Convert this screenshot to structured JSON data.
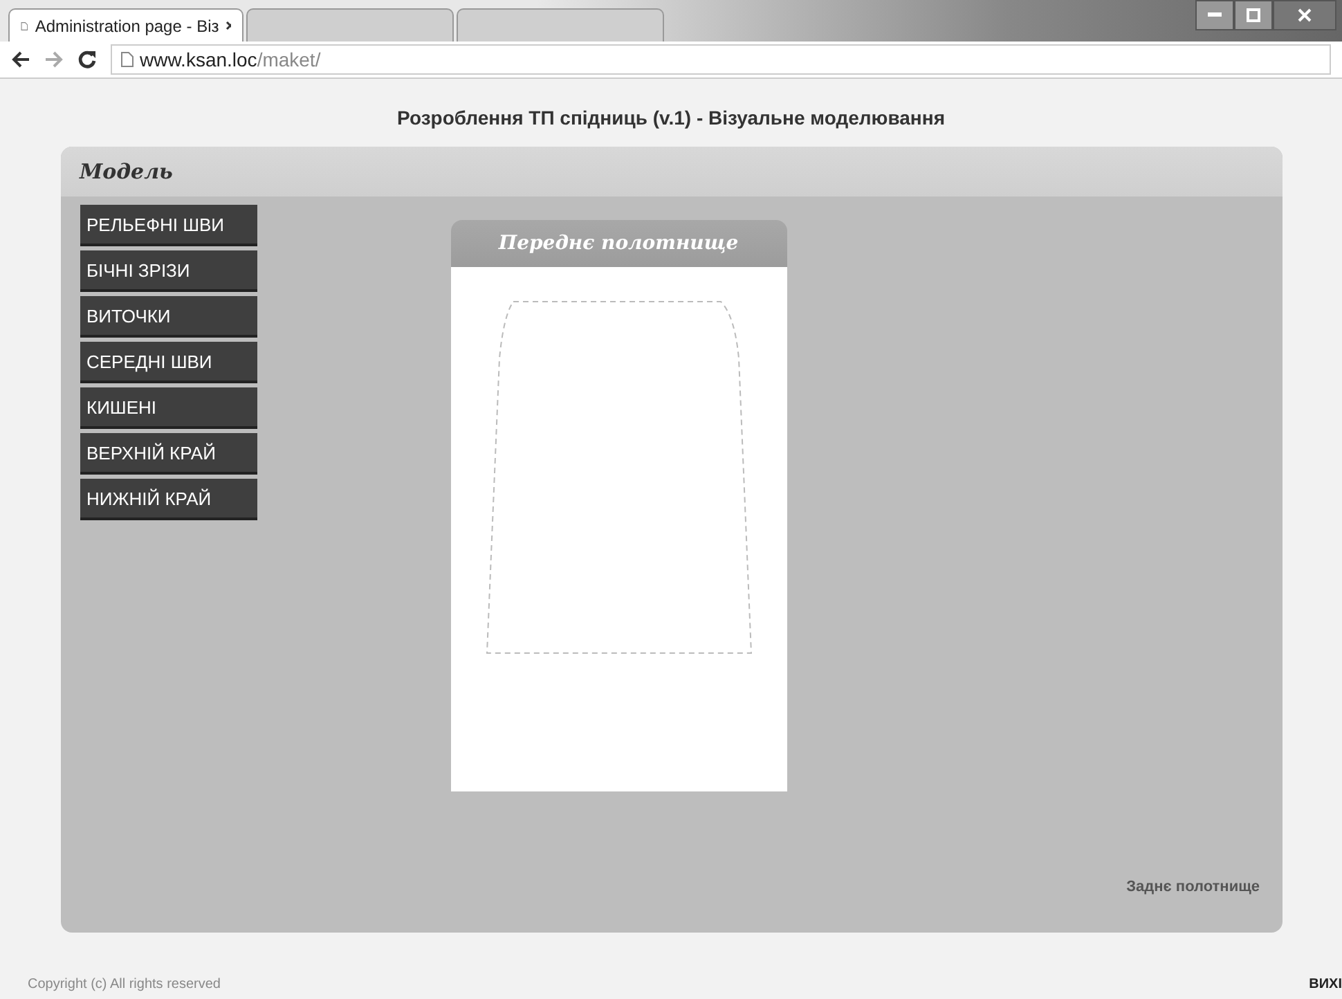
{
  "browser": {
    "tabs": [
      {
        "label": "Administration page - Віз",
        "selected": true
      }
    ],
    "address": {
      "host": "www.ksan.loc",
      "path": "/maket/"
    }
  },
  "page_title": "Розроблення ТП спідниць (v.1) - Візуальне моделювання",
  "panel": {
    "title": "Модель",
    "menu": [
      {
        "label": "РЕЛЬЕФНІ ШВИ"
      },
      {
        "label": "БІЧНІ ЗРІЗИ"
      },
      {
        "label": "ВИТОЧКИ"
      },
      {
        "label": "СЕРЕДНІ ШВИ"
      },
      {
        "label": "КИШЕНІ"
      },
      {
        "label": "ВЕРХНІЙ КРАЙ"
      },
      {
        "label": "НИЖНІЙ КРАЙ"
      }
    ],
    "canvas": {
      "title": "Переднє полотнище"
    },
    "back_link": "Заднє полотнище"
  },
  "footer": {
    "copyright": "Copyright (c) All rights reserved",
    "logout": "ВИХІ"
  }
}
